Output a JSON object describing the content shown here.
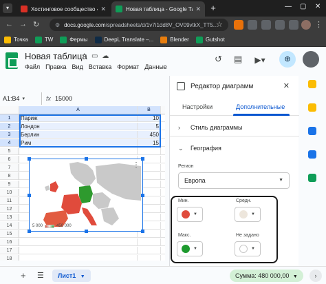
{
  "browser": {
    "tabs": [
      {
        "title": "Хостинговое сообщество «Ti",
        "active": false
      },
      {
        "title": "Новая таблица - Google Табл",
        "active": true
      }
    ],
    "url_host": "docs.google.com",
    "url_path": "/spreadsheets/d/1v7i1dd8V_OV09vtkX_TT5..."
  },
  "bookmarks": [
    {
      "label": "Точка"
    },
    {
      "label": "TW"
    },
    {
      "label": "Фермы"
    },
    {
      "label": "DeepL Translate –..."
    },
    {
      "label": "Blender"
    },
    {
      "label": "Gutshot"
    }
  ],
  "sheets": {
    "doc_title": "Новая таблица",
    "menu": [
      "Файл",
      "Правка",
      "Вид",
      "Вставка",
      "Формат",
      "Данные"
    ],
    "name_box": "A1:B4",
    "formula_value": "15000",
    "columns": [
      "A",
      "B"
    ],
    "rows": [
      {
        "num": "1",
        "a": "Париж",
        "b": "10"
      },
      {
        "num": "2",
        "a": "Лондон",
        "b": "5"
      },
      {
        "num": "3",
        "a": "Берлин",
        "b": "450"
      },
      {
        "num": "4",
        "a": "Рим",
        "b": "15"
      },
      {
        "num": "5",
        "a": "",
        "b": ""
      },
      {
        "num": "6",
        "a": "",
        "b": ""
      },
      {
        "num": "7",
        "a": "",
        "b": ""
      },
      {
        "num": "8",
        "a": "",
        "b": ""
      },
      {
        "num": "9",
        "a": "",
        "b": ""
      },
      {
        "num": "10",
        "a": "",
        "b": ""
      },
      {
        "num": "11",
        "a": "",
        "b": ""
      },
      {
        "num": "12",
        "a": "",
        "b": ""
      },
      {
        "num": "13",
        "a": "",
        "b": ""
      },
      {
        "num": "14",
        "a": "",
        "b": ""
      },
      {
        "num": "15",
        "a": "",
        "b": ""
      },
      {
        "num": "16",
        "a": "",
        "b": ""
      },
      {
        "num": "17",
        "a": "",
        "b": ""
      },
      {
        "num": "18",
        "a": "",
        "b": ""
      }
    ],
    "chart_legend": {
      "min": "5 000",
      "max": "450 000"
    },
    "sheet_tab": "Лист1",
    "sum_label": "Сумма: 480 000,00"
  },
  "editor": {
    "title": "Редактор диаграмм",
    "tabs": [
      "Настройки",
      "Дополнительные"
    ],
    "active_tab": 1,
    "sections": [
      {
        "label": "Стиль диаграммы",
        "expanded": false
      },
      {
        "label": "География",
        "expanded": true
      }
    ],
    "region_label": "Регион",
    "region_value": "Европа",
    "colors": [
      {
        "label": "Мин.",
        "color": "#e04b3c"
      },
      {
        "label": "Средн.",
        "color": "#ede6dc"
      },
      {
        "label": "Макс.",
        "color": "#1e9a2e"
      },
      {
        "label": "Не задано",
        "color": "#ffffff"
      }
    ]
  }
}
